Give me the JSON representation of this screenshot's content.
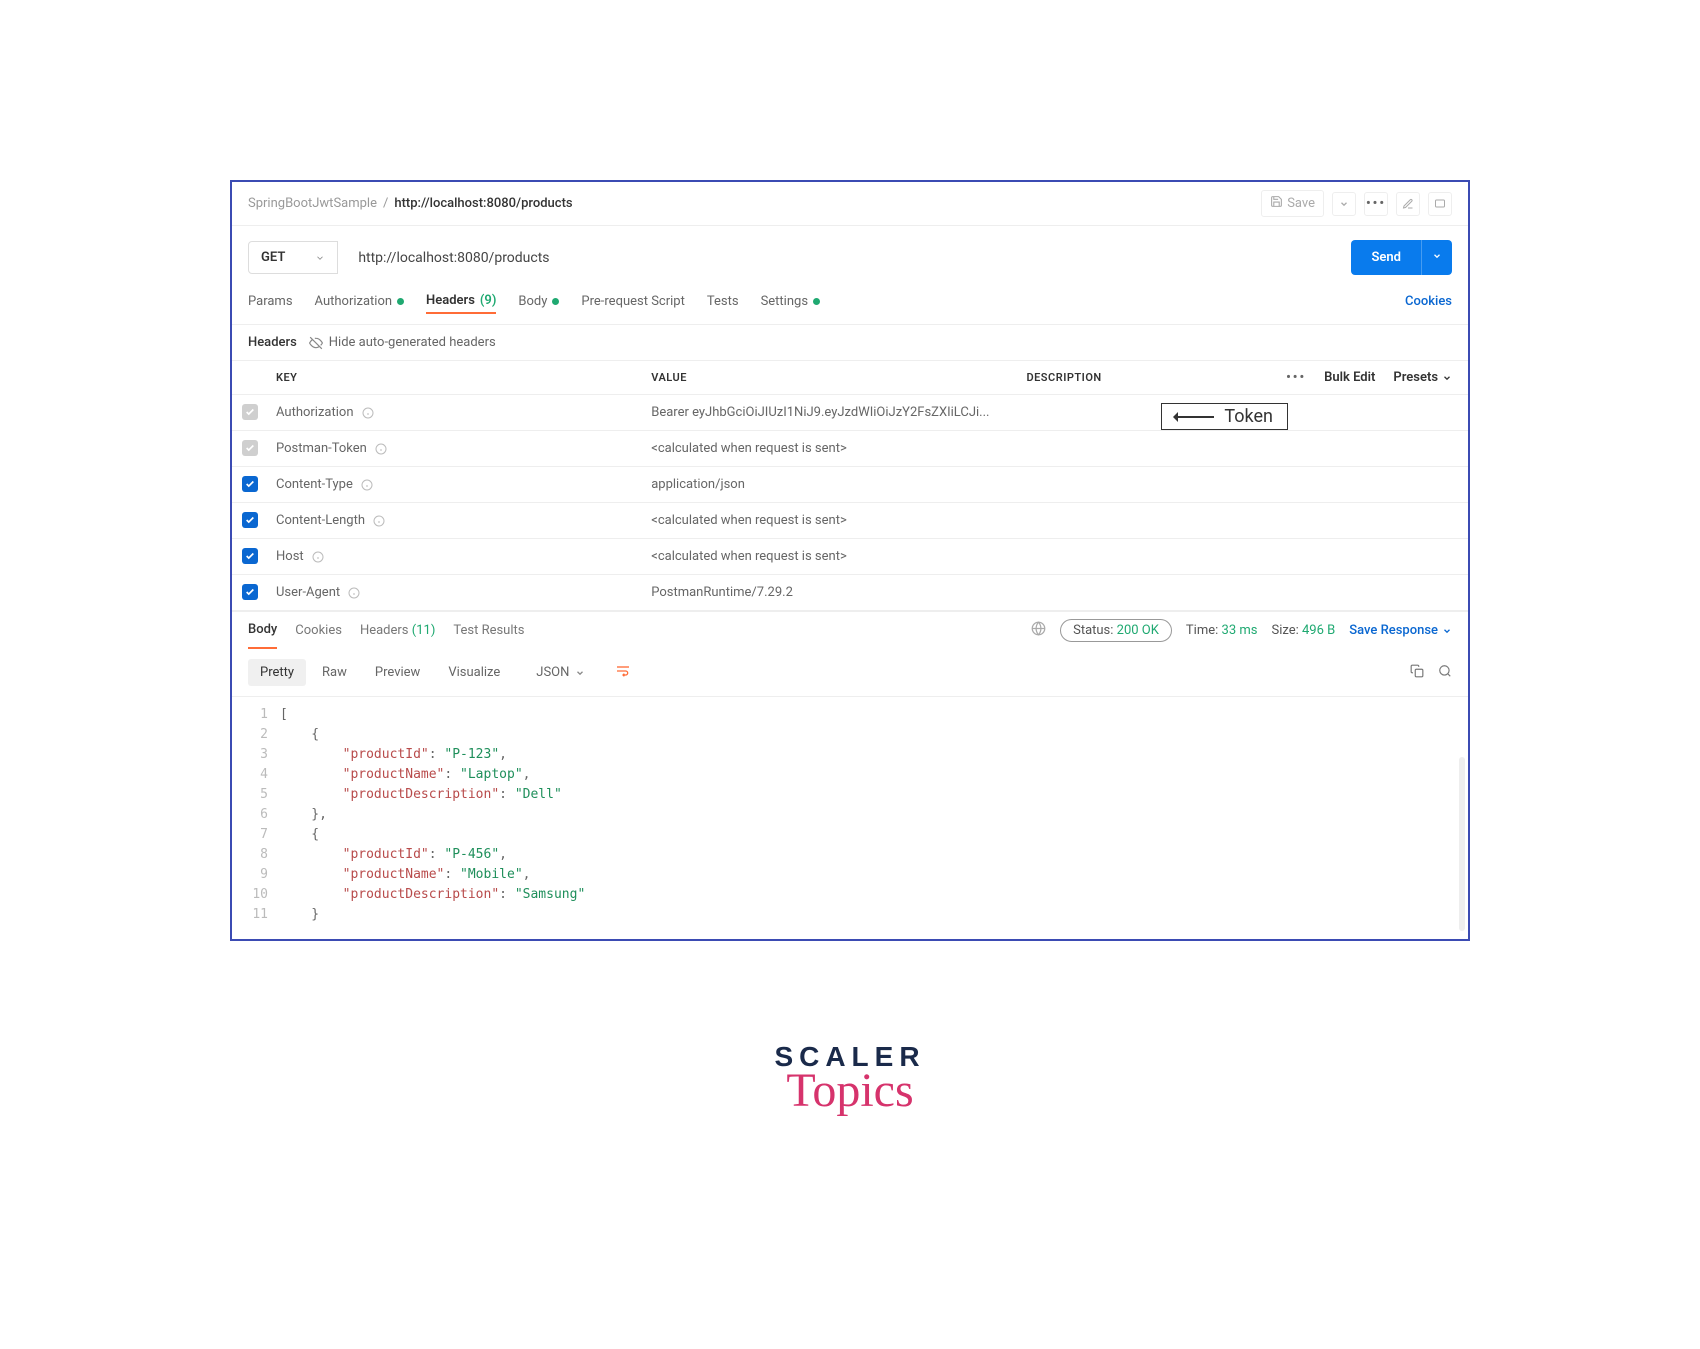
{
  "breadcrumb": {
    "project": "SpringBootJwtSample",
    "request": "http://localhost:8080/products"
  },
  "topbar": {
    "save": "Save"
  },
  "request": {
    "method": "GET",
    "url": "http://localhost:8080/products",
    "send": "Send"
  },
  "reqTabs": {
    "params": "Params",
    "authorization": "Authorization",
    "headers": "Headers",
    "headersCount": "(9)",
    "body": "Body",
    "prereq": "Pre-request Script",
    "tests": "Tests",
    "settings": "Settings",
    "cookies": "Cookies"
  },
  "subhead": {
    "label": "Headers",
    "hide": "Hide auto-generated headers"
  },
  "headersTable": {
    "cols": {
      "key": "KEY",
      "value": "VALUE",
      "desc": "DESCRIPTION"
    },
    "actions": {
      "bulk": "Bulk Edit",
      "presets": "Presets"
    },
    "rows": [
      {
        "enabled": false,
        "key": "Authorization",
        "value": "Bearer eyJhbGciOiJIUzI1NiJ9.eyJzdWIiOiJzY2FsZXIiLCJi...",
        "desc": ""
      },
      {
        "enabled": false,
        "key": "Postman-Token",
        "value": "<calculated when request is sent>",
        "desc": ""
      },
      {
        "enabled": true,
        "key": "Content-Type",
        "value": "application/json",
        "desc": ""
      },
      {
        "enabled": true,
        "key": "Content-Length",
        "value": "<calculated when request is sent>",
        "desc": ""
      },
      {
        "enabled": true,
        "key": "Host",
        "value": "<calculated when request is sent>",
        "desc": ""
      },
      {
        "enabled": true,
        "key": "User-Agent",
        "value": "PostmanRuntime/7.29.2",
        "desc": ""
      }
    ]
  },
  "annotation": {
    "label": "Token"
  },
  "respTabs": {
    "body": "Body",
    "cookies": "Cookies",
    "headers": "Headers",
    "headersCount": "(11)",
    "tests": "Test Results"
  },
  "respMeta": {
    "statusLabel": "Status:",
    "statusValue": "200 OK",
    "timeLabel": "Time:",
    "timeValue": "33 ms",
    "sizeLabel": "Size:",
    "sizeValue": "496 B",
    "save": "Save Response"
  },
  "viewTabs": {
    "pretty": "Pretty",
    "raw": "Raw",
    "preview": "Preview",
    "visualize": "Visualize",
    "format": "JSON"
  },
  "responseBody": [
    {
      "indent": 0,
      "text": "["
    },
    {
      "indent": 1,
      "text": "{"
    },
    {
      "indent": 2,
      "key": "productId",
      "value": "P-123",
      "comma": true
    },
    {
      "indent": 2,
      "key": "productName",
      "value": "Laptop",
      "comma": true
    },
    {
      "indent": 2,
      "key": "productDescription",
      "value": "Dell",
      "comma": false
    },
    {
      "indent": 1,
      "text": "},"
    },
    {
      "indent": 1,
      "text": "{"
    },
    {
      "indent": 2,
      "key": "productId",
      "value": "P-456",
      "comma": true
    },
    {
      "indent": 2,
      "key": "productName",
      "value": "Mobile",
      "comma": true
    },
    {
      "indent": 2,
      "key": "productDescription",
      "value": "Samsung",
      "comma": false
    },
    {
      "indent": 1,
      "text": "}"
    }
  ],
  "logo": {
    "line1": "SCALER",
    "line2": "Topics"
  }
}
